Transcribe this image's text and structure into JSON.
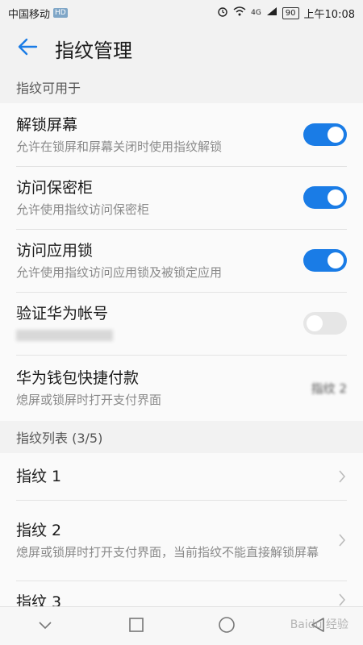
{
  "status_bar": {
    "carrier": "中国移动",
    "hd_badge": "HD",
    "network": "4G",
    "battery": "90",
    "time": "上午10:08"
  },
  "app_bar": {
    "title": "指纹管理",
    "back_icon": "arrow-left-icon"
  },
  "section_use": {
    "header": "指纹可用于",
    "items": [
      {
        "title": "解锁屏幕",
        "subtitle": "允许在锁屏和屏幕关闭时使用指纹解锁",
        "toggle": true
      },
      {
        "title": "访问保密柜",
        "subtitle": "允许使用指纹访问保密柜",
        "toggle": true
      },
      {
        "title": "访问应用锁",
        "subtitle": "允许使用指纹访问应用锁及被锁定应用",
        "toggle": true
      },
      {
        "title": "验证华为帐号",
        "subtitle": "",
        "toggle": false
      },
      {
        "title": "华为钱包快捷付款",
        "subtitle": "熄屏或锁屏时打开支付界面",
        "value": "指纹 2"
      }
    ]
  },
  "section_list": {
    "header": "指纹列表 (3/5)",
    "items": [
      {
        "title": "指纹 1",
        "subtitle": ""
      },
      {
        "title": "指纹 2",
        "subtitle": "熄屏或锁屏时打开支付界面，当前指纹不能直接解锁屏幕"
      },
      {
        "title": "指纹 3",
        "subtitle": ""
      }
    ]
  },
  "nav_bar": {
    "icons": [
      "chevron-down-icon",
      "square-icon",
      "circle-icon",
      "triangle-back-icon"
    ]
  },
  "watermark": "Baidu 经验",
  "colors": {
    "accent": "#1a7ce6",
    "background": "#f2f2f2",
    "card": "#fafafa"
  }
}
